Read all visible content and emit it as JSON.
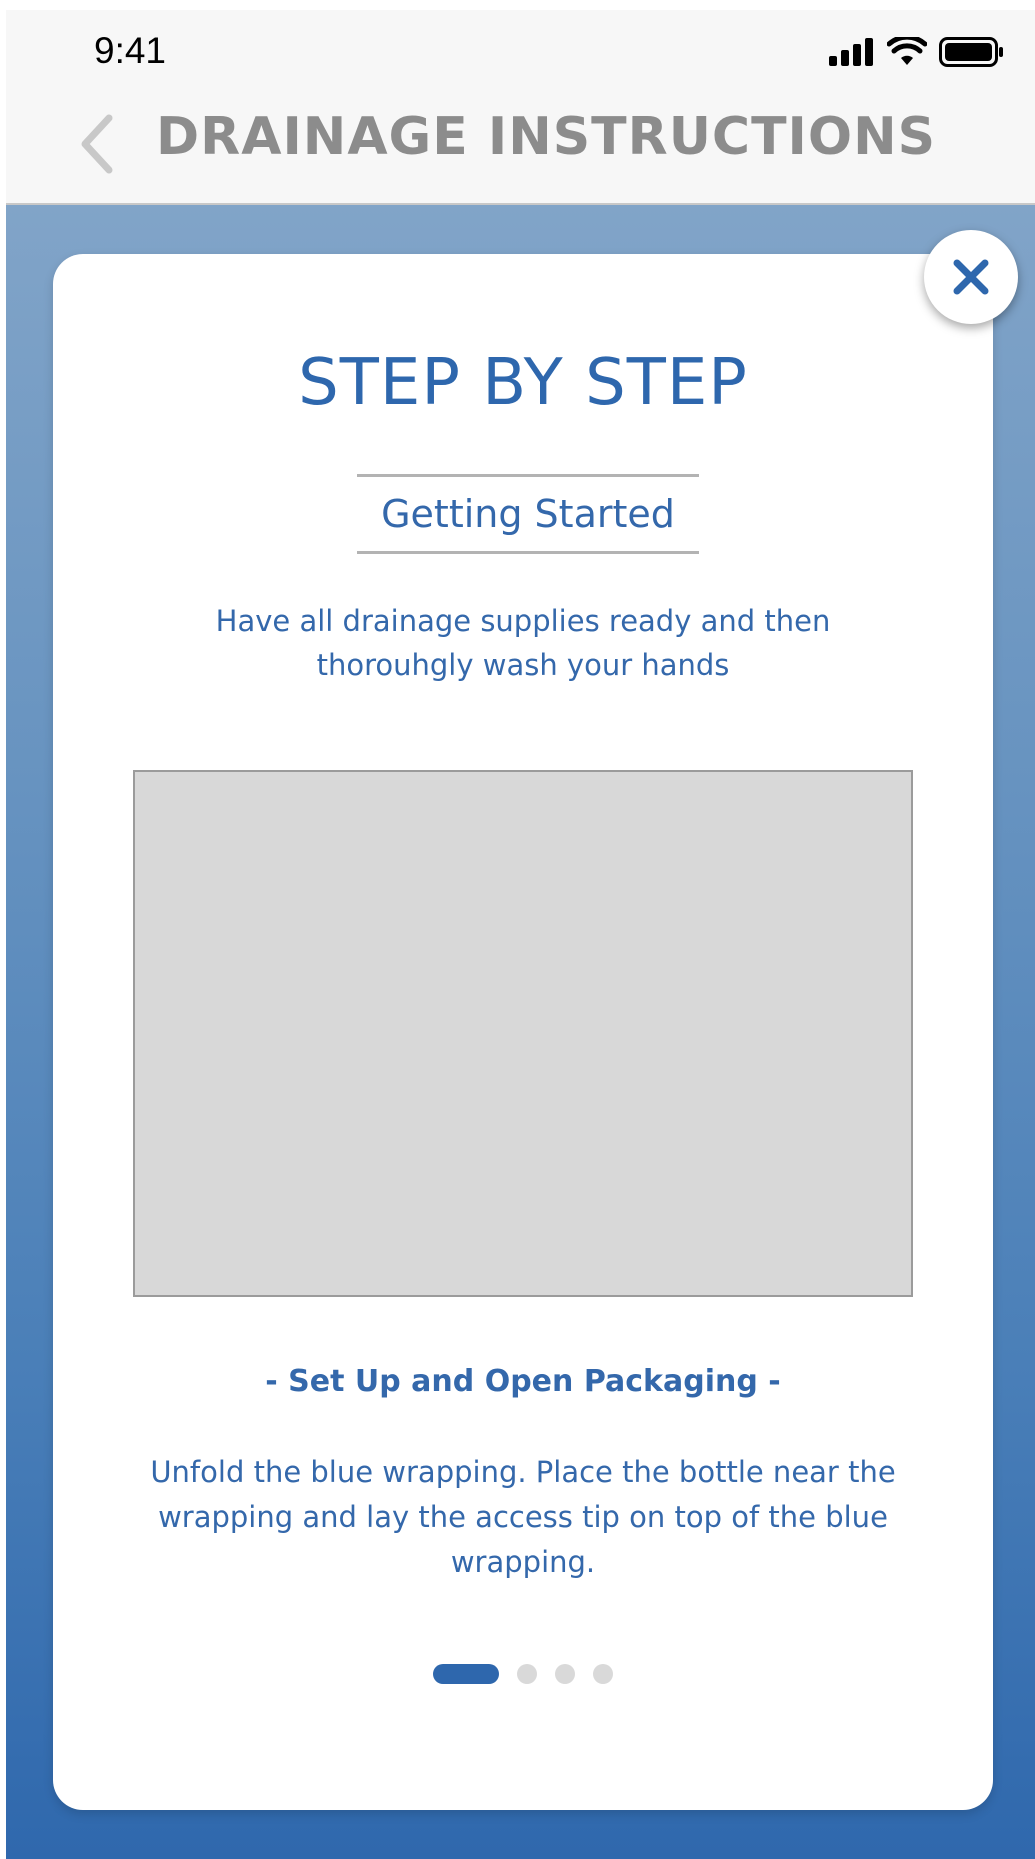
{
  "status_bar": {
    "time": "9:41"
  },
  "nav": {
    "title": "DRAINAGE INSTRUCTIONS",
    "back_icon": "chevron-left-icon"
  },
  "modal": {
    "title": "STEP BY STEP",
    "section_label": "Getting Started",
    "intro": "Have all drainage supplies ready and then thorouhgly wash your hands",
    "step_heading": "- Set Up and Open Packaging -",
    "step_body": "Unfold the blue wrapping. Place the bottle near the wrapping and lay the access tip on top of the blue wrapping.",
    "close_icon": "close-icon",
    "pager": {
      "total": 4,
      "current": 1
    }
  },
  "colors": {
    "accent": "#2e67ad",
    "text_blue": "#3468ab",
    "nav_title": "#8c8c8c",
    "placeholder": "#d8d8d8",
    "bg_top": "#81a4c8",
    "bg_bottom": "#2f68ad"
  }
}
